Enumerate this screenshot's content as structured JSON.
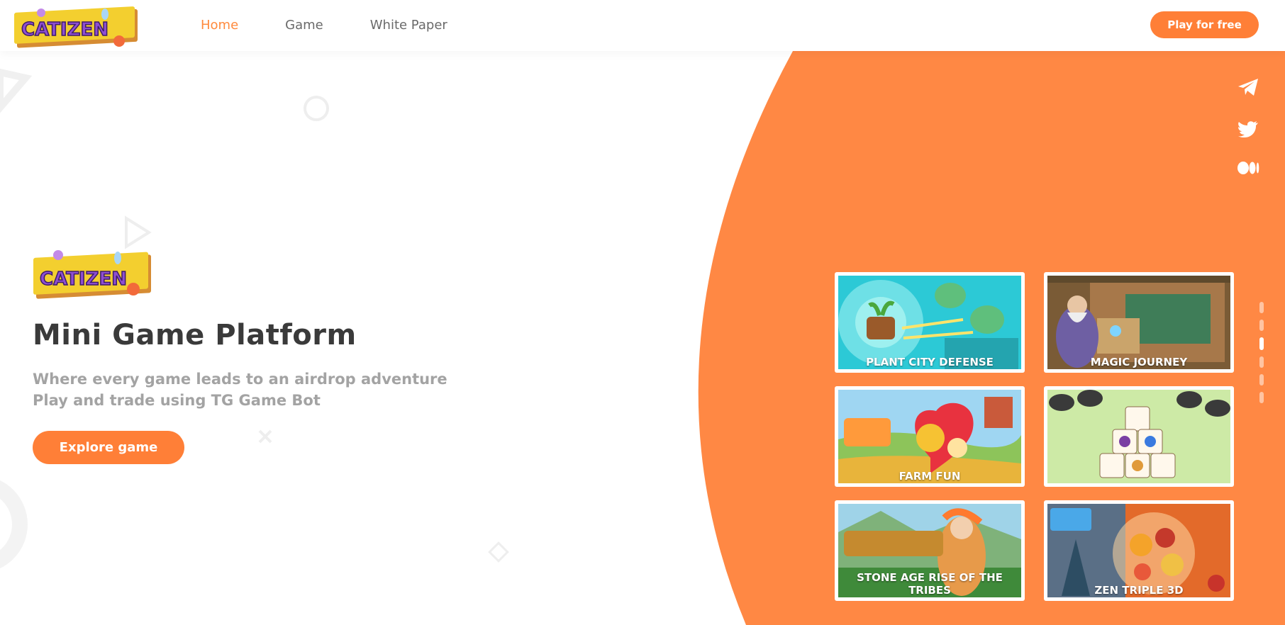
{
  "brand": {
    "logo_text": "CATIZEN",
    "accent": "#ff7f37",
    "nav_active": "#ff8a3d"
  },
  "nav": {
    "items": [
      {
        "label": "Home",
        "active": true
      },
      {
        "label": "Game",
        "active": false
      },
      {
        "label": "White Paper",
        "active": false
      }
    ],
    "cta": "Play for free"
  },
  "hero": {
    "title": "Mini Game Platform",
    "subtitle_line1": "Where every game leads to an airdrop adventure",
    "subtitle_line2": "Play and trade using TG Game Bot",
    "button": "Explore game"
  },
  "social": [
    {
      "icon": "telegram-icon"
    },
    {
      "icon": "twitter-icon"
    },
    {
      "icon": "medium-icon"
    }
  ],
  "games": [
    {
      "title": "PLANT CITY DEFENSE"
    },
    {
      "title": "MAGIC JOURNEY"
    },
    {
      "title": "FARM FUN"
    },
    {
      "title": ""
    },
    {
      "title": "STONE AGE RISE OF THE TRIBES"
    },
    {
      "title": "ZEN TRIPLE 3D"
    }
  ],
  "carousel": {
    "pages": 6,
    "current": 3
  }
}
